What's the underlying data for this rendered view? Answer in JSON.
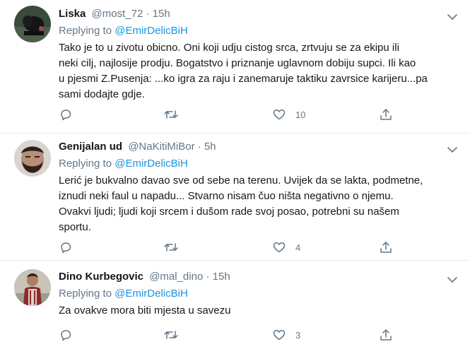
{
  "tweets": [
    {
      "name": "Liska",
      "handle": "@most_72",
      "time": "15h",
      "replying_prefix": "Replying to",
      "replying_to": "@EmirDelicBiH",
      "lines": [
        "Tako je to u zivotu obicno. Oni koji udju cistog srca, zrtvuju se za ekipu ili",
        "neki cilj, najlosije prodju. Bogatstvo i priznanje uglavnom dobiju supci. Ili kao",
        "u pjesmi Z.Pusenja: ...ko igra za raju i zanemaruje taktiku zavrsice karijeru...pa",
        "sami dodajte gdje."
      ],
      "likes": "10",
      "avatar_color": "#3a4a3c"
    },
    {
      "name": "Genijalan ud",
      "handle": "@NaKitiMiBor",
      "time": "5h",
      "replying_prefix": "Replying to",
      "replying_to": "@EmirDelicBiH",
      "lines": [
        "Lerić je bukvalno davao sve od sebe na terenu. Uvijek da se lakta, podmetne,",
        "iznudi neki faul u napadu... Stvarno nisam čuo ništa negativno o njemu.",
        "Ovakvi ljudi; ljudi koji srcem i dušom rade svoj posao, potrebni su našem",
        "sportu."
      ],
      "likes": "4",
      "avatar_color": "#6b5a4e"
    },
    {
      "name": "Dino Kurbegovic",
      "handle": "@mal_dino",
      "time": "15h",
      "replying_prefix": "Replying to",
      "replying_to": "@EmirDelicBiH",
      "lines": [
        "Za ovakve mora biti mjesta u savezu"
      ],
      "likes": "3",
      "avatar_color": "#8a6a58"
    }
  ],
  "separator": " · ",
  "colors": {
    "text": "#14171a",
    "muted": "#657786",
    "link": "#1b95e0",
    "divider": "#e6ecf0"
  },
  "icons": [
    "reply-icon",
    "retweet-icon",
    "like-icon",
    "share-icon",
    "chevron-down-icon"
  ]
}
